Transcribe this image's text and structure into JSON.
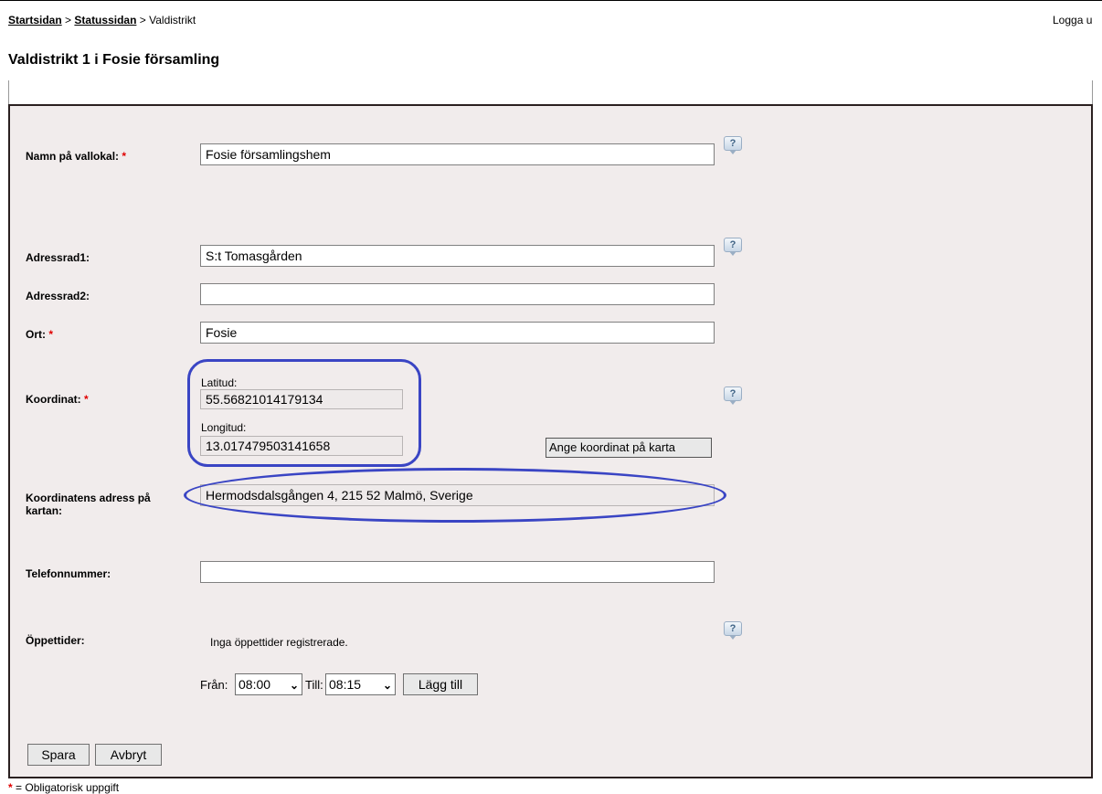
{
  "breadcrumb": {
    "home": "Startsidan",
    "sep1": ">",
    "status": "Statussidan",
    "sep2": ">",
    "current": "Valdistrikt"
  },
  "logout_label": "Logga u",
  "page_title": "Valdistrikt 1 i Fosie församling",
  "form": {
    "name_label": "Namn på vallokal:",
    "name_value": "Fosie församlingshem",
    "address1_label": "Adressrad1:",
    "address1_value": "S:t Tomasgården",
    "address2_label": "Adressrad2:",
    "address2_value": "",
    "city_label": "Ort:",
    "city_value": "Fosie",
    "coord_label": "Koordinat:",
    "lat_label": "Latitud:",
    "lat_value": "55.56821014179134",
    "lon_label": "Longitud:",
    "lon_value": "13.017479503141658",
    "set_coord_button": "Ange koordinat på karta",
    "coord_address_label": "Koordinatens adress på kartan:",
    "coord_address_value": "Hermodsdalsgången 4, 215 52 Malmö, Sverige",
    "phone_label": "Telefonnummer:",
    "phone_value": "",
    "opening_label": "Öppettider:",
    "opening_empty": "Inga öppettider registrerade.",
    "from_label": "Från:",
    "from_value": "08:00",
    "to_label": "Till:",
    "to_value": "08:15",
    "add_button": "Lägg till",
    "save_button": "Spara",
    "cancel_button": "Avbryt",
    "required_marker": "*",
    "help_glyph": "?"
  },
  "footer_note": "= Obligatorisk uppgift",
  "colors": {
    "panel_bg": "#f1ecec",
    "required": "#e00000",
    "annotation_oval": "#3a45c4"
  }
}
